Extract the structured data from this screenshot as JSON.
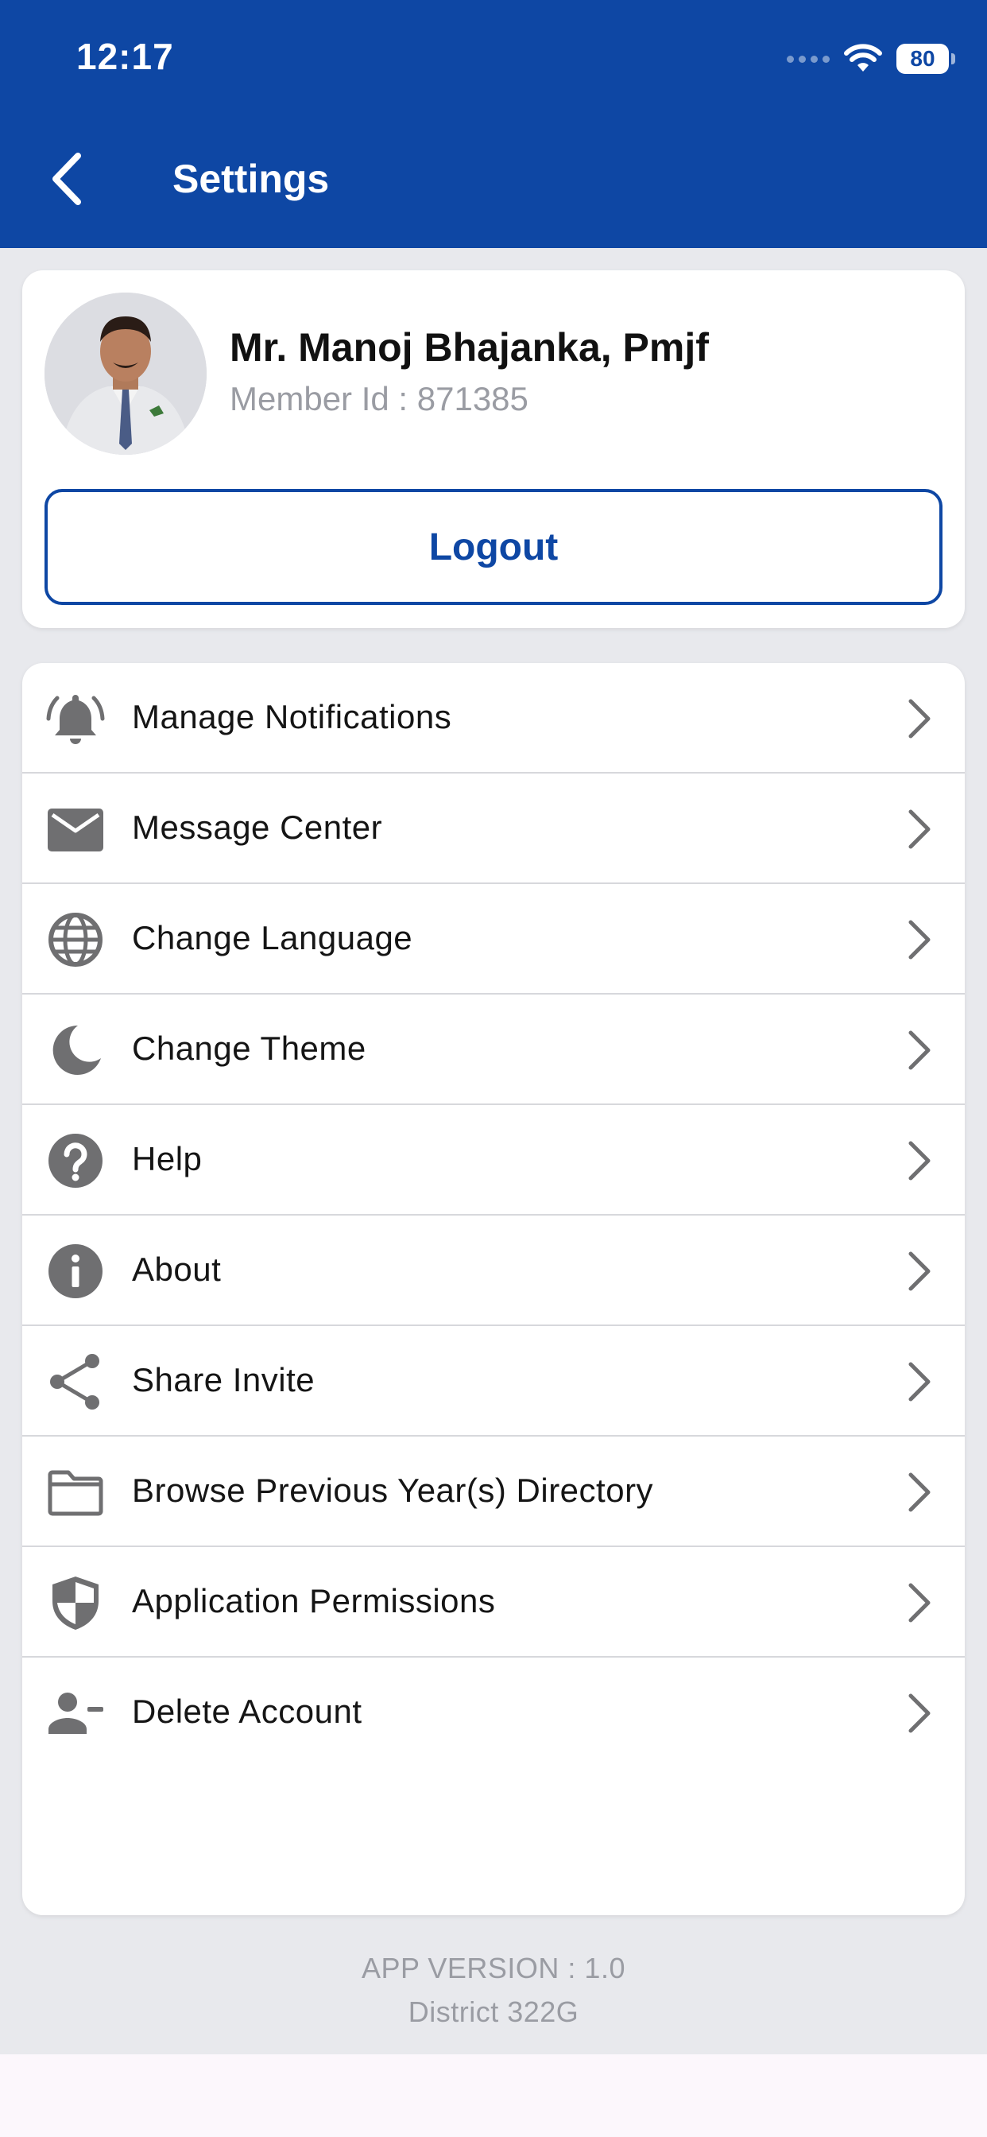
{
  "status_bar": {
    "time": "12:17",
    "battery": "80"
  },
  "header": {
    "title": "Settings"
  },
  "profile": {
    "name": "Mr. Manoj Bhajanka, Pmjf",
    "member_id": "Member Id : 871385",
    "logout_label": "Logout"
  },
  "menu": {
    "items": [
      {
        "label": "Manage Notifications",
        "icon": "bell-icon"
      },
      {
        "label": "Message Center",
        "icon": "mail-icon"
      },
      {
        "label": "Change Language",
        "icon": "globe-icon"
      },
      {
        "label": "Change Theme",
        "icon": "moon-icon"
      },
      {
        "label": "Help",
        "icon": "help-icon"
      },
      {
        "label": "About",
        "icon": "info-icon"
      },
      {
        "label": "Share Invite",
        "icon": "share-icon"
      },
      {
        "label": "Browse Previous Year(s) Directory",
        "icon": "folder-icon"
      },
      {
        "label": "Application Permissions",
        "icon": "shield-icon"
      },
      {
        "label": "Delete Account",
        "icon": "remove-user-icon"
      }
    ]
  },
  "footer": {
    "app_version": "APP VERSION : 1.0",
    "district": "District 322G"
  },
  "colors": {
    "primary": "#0e47a4",
    "background": "#e8e9ed",
    "icon_gray": "#6f6f71",
    "muted_text": "#9a9ca3"
  }
}
